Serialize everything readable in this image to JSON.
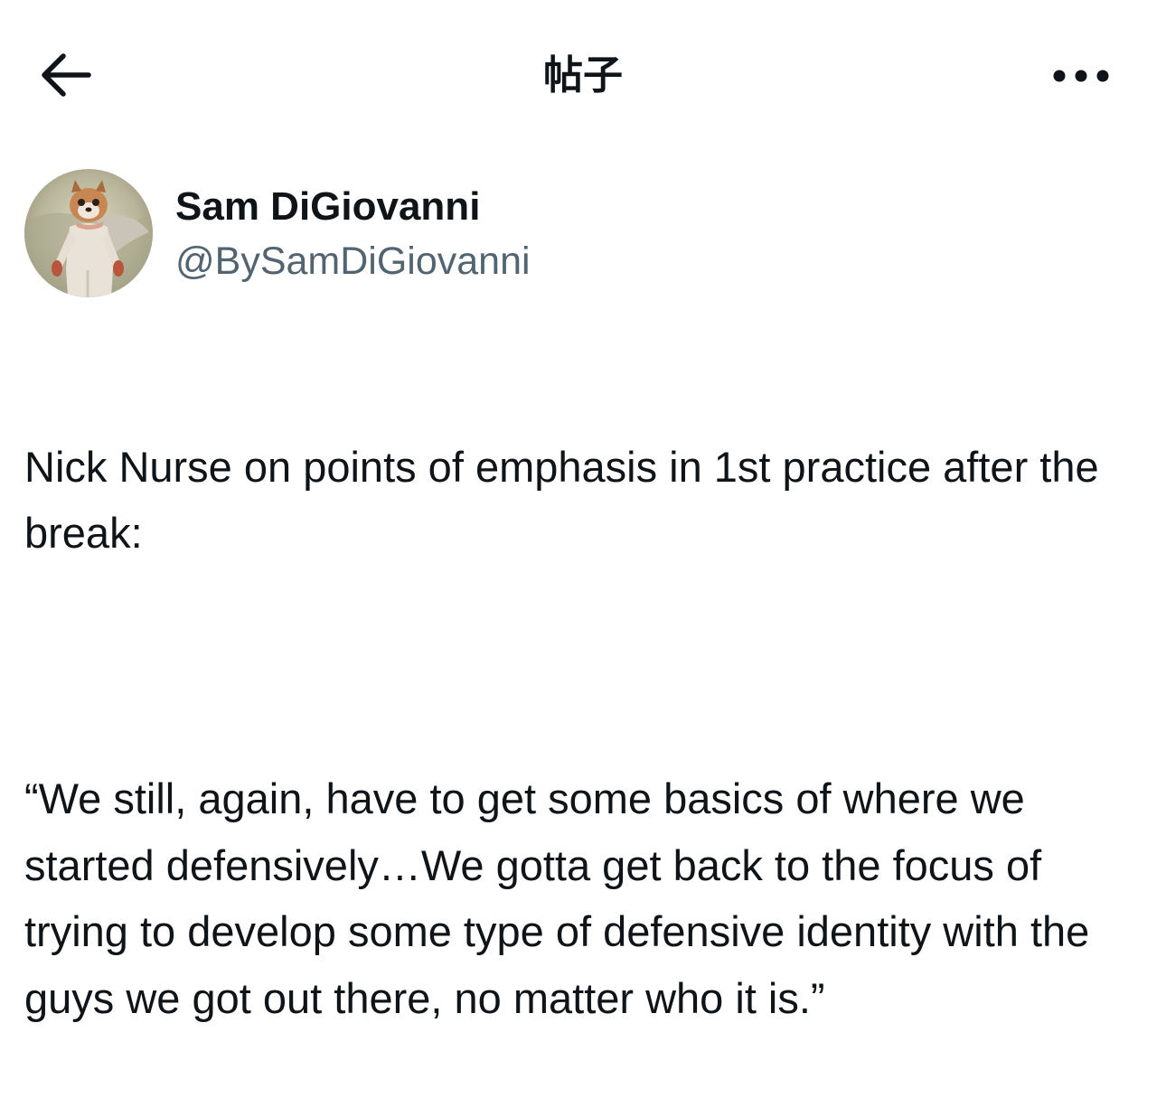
{
  "header": {
    "back_icon": "arrow-left-icon",
    "title": "帖子",
    "more_icon": "more-horizontal-icon"
  },
  "author": {
    "avatar_icon": "profile-avatar",
    "display_name": "Sam DiGiovanni",
    "handle": "@BySamDiGiovanni"
  },
  "post": {
    "paragraphs": [
      "Nick Nurse on points of emphasis in 1st practice after the break:",
      "“We still, again, have to get some basics of where we started defensively…We gotta get back to the focus of trying to develop some type of defensive identity with the guys we got out there, no matter who it is.”"
    ]
  },
  "colors": {
    "text_primary": "#0f1419",
    "text_secondary": "#536471",
    "background": "#ffffff"
  }
}
